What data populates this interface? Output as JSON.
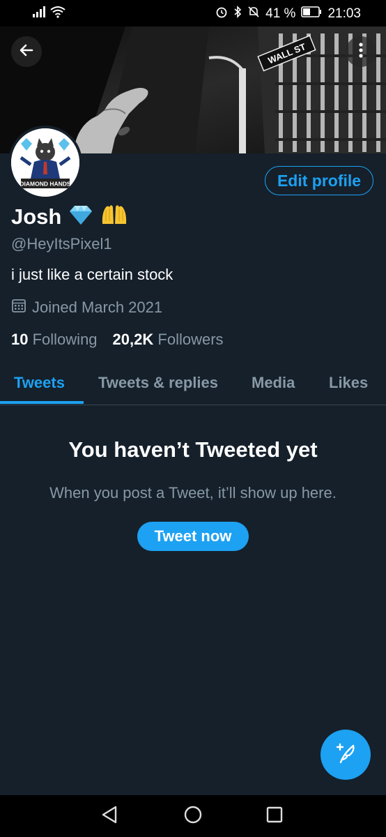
{
  "status_bar": {
    "time": "21:03",
    "battery": "41 %",
    "icons": [
      "signal-icon",
      "wifi-icon",
      "alarm-icon",
      "bluetooth-icon",
      "mute-icon",
      "battery-icon"
    ]
  },
  "banner": {
    "sign_text": "WALL ST"
  },
  "avatar": {
    "badge_text": "DIAMOND HANDS"
  },
  "profile": {
    "name": "Josh",
    "name_emoji": [
      "gem-emoji",
      "raising-hands-emoji"
    ],
    "handle": "@HeyItsPixel1",
    "bio": "i just like a certain stock",
    "joined": "Joined March 2021",
    "following_count": "10",
    "following_label": "Following",
    "followers_count": "20,2K",
    "followers_label": "Followers",
    "edit_label": "Edit profile"
  },
  "tabs": [
    {
      "label": "Tweets",
      "active": true
    },
    {
      "label": "Tweets & replies",
      "active": false
    },
    {
      "label": "Media",
      "active": false
    },
    {
      "label": "Likes",
      "active": false
    }
  ],
  "empty_state": {
    "title": "You haven’t Tweeted yet",
    "subtitle": "When you post a Tweet, it’ll show up here.",
    "button": "Tweet now"
  },
  "colors": {
    "background": "#15202b",
    "accent": "#1da1f2",
    "secondary_text": "#8899a6",
    "divider": "#38444d"
  }
}
